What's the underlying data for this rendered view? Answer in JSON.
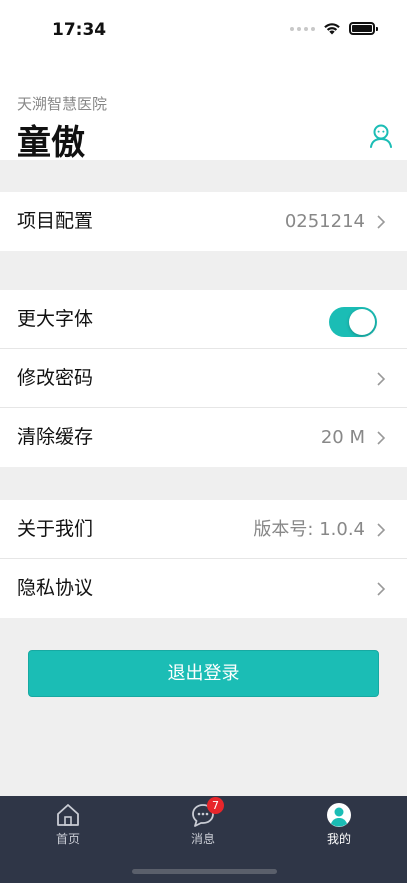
{
  "status_bar": {
    "time": "17:34"
  },
  "header": {
    "hospital_name": "天溯智慧医院",
    "user_name": "童傲",
    "profile_icon": "user-profile-icon"
  },
  "settings": {
    "project_config": {
      "label": "项目配置",
      "value": "0251214"
    },
    "larger_font": {
      "label": "更大字体",
      "enabled": true
    },
    "change_password": {
      "label": "修改密码"
    },
    "clear_cache": {
      "label": "清除缓存",
      "value": "20 M"
    },
    "about_us": {
      "label": "关于我们",
      "value": "版本号: 1.0.4"
    },
    "privacy": {
      "label": "隐私协议"
    }
  },
  "logout_label": "退出登录",
  "tabbar": {
    "tabs": [
      {
        "label": "首页",
        "icon": "home-icon"
      },
      {
        "label": "消息",
        "icon": "message-icon",
        "badge": "7"
      },
      {
        "label": "我的",
        "icon": "person-icon",
        "active": true
      }
    ]
  },
  "colors": {
    "accent": "#1bbdb5",
    "tabbar": "#2f3647",
    "badge": "#e8262b"
  }
}
